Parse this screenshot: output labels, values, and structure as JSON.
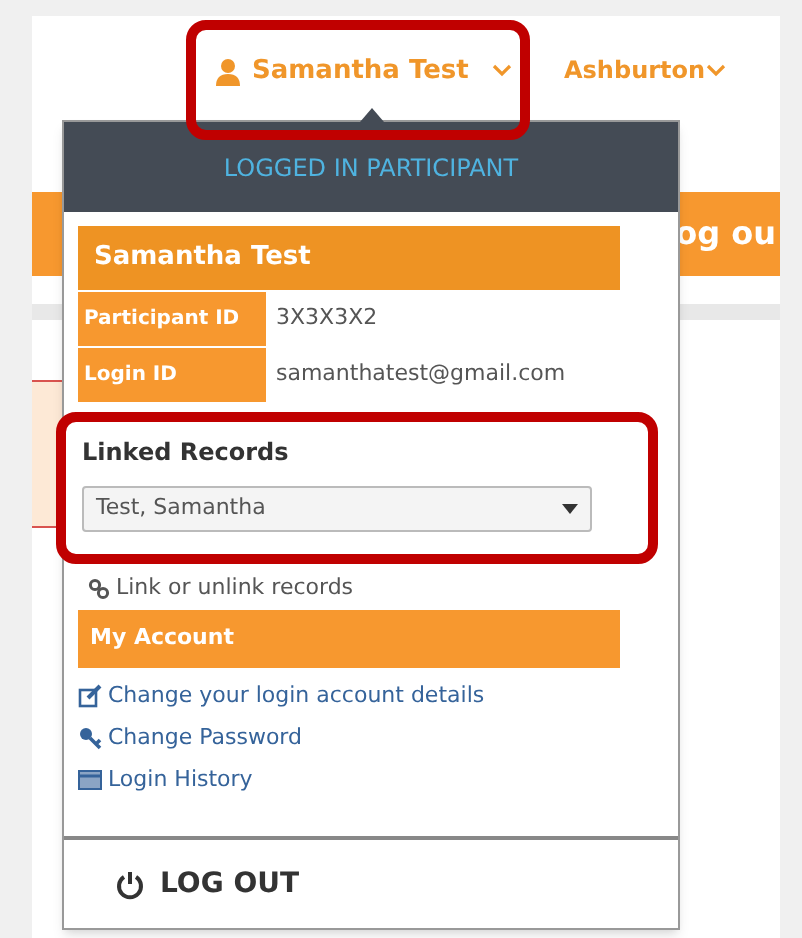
{
  "header": {
    "user_name": "Samantha Test",
    "location": "Ashburton"
  },
  "page": {
    "partial_button": "og ou"
  },
  "dropdown": {
    "title": "LOGGED IN PARTICIPANT",
    "name": "Samantha Test",
    "fields": [
      {
        "label": "Participant ID",
        "value": "3X3X3X2"
      },
      {
        "label": "Login ID",
        "value": "samanthatest@gmail.com"
      }
    ],
    "linked_records": {
      "title": "Linked Records",
      "value": "Test, Samantha",
      "link": "Link or unlink records"
    },
    "account": {
      "title": "My Account",
      "links": [
        {
          "kind": "edit",
          "label": "Change your login account details"
        },
        {
          "kind": "key",
          "label": "Change Password"
        },
        {
          "kind": "history",
          "label": "Login History"
        }
      ]
    },
    "logout": "LOG OUT"
  }
}
